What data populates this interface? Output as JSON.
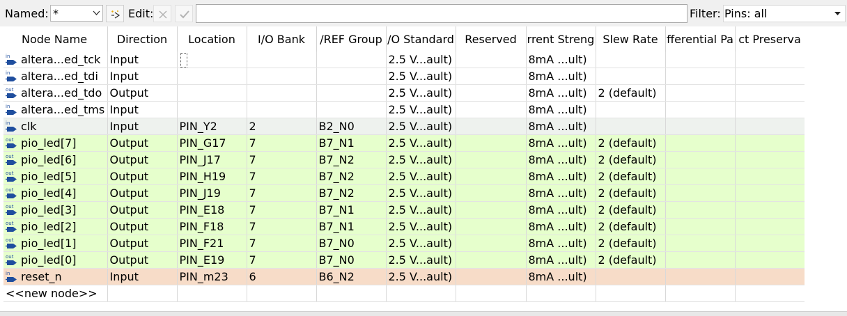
{
  "toolbar": {
    "named_label": "Named:",
    "named_value": "*",
    "edit_label": "Edit:",
    "edit_value": "",
    "filter_label": "Filter:",
    "filter_value": "Pins: all"
  },
  "table": {
    "columns": [
      "Node Name",
      "Direction",
      "Location",
      "I/O Bank",
      "/REF Group",
      "/O Standard",
      "Reserved",
      "rrent Streng",
      "Slew Rate",
      "fferential Pa",
      "ct Preserva"
    ],
    "rows": [
      {
        "dir_icon": "in",
        "name": "altera...ed_tck",
        "direction": "Input",
        "location": "",
        "bank": "",
        "vref": "",
        "std": "2.5 V...ault)",
        "reserved": "",
        "current": "8mA ...ult)",
        "slew": "",
        "diff": "",
        "preserve": "",
        "style": "default",
        "marker": true
      },
      {
        "dir_icon": "in",
        "name": "altera...ed_tdi",
        "direction": "Input",
        "location": "",
        "bank": "",
        "vref": "",
        "std": "2.5 V...ault)",
        "reserved": "",
        "current": "8mA ...ult)",
        "slew": "",
        "diff": "",
        "preserve": "",
        "style": "default"
      },
      {
        "dir_icon": "out",
        "name": "altera...ed_tdo",
        "direction": "Output",
        "location": "",
        "bank": "",
        "vref": "",
        "std": "2.5 V...ault)",
        "reserved": "",
        "current": "8mA ...ult)",
        "slew": "2 (default)",
        "diff": "",
        "preserve": "",
        "style": "default"
      },
      {
        "dir_icon": "in",
        "name": "altera...ed_tms",
        "direction": "Input",
        "location": "",
        "bank": "",
        "vref": "",
        "std": "2.5 V...ault)",
        "reserved": "",
        "current": "8mA ...ult)",
        "slew": "",
        "diff": "",
        "preserve": "",
        "style": "default"
      },
      {
        "dir_icon": "in",
        "name": "clk",
        "direction": "Input",
        "location": "PIN_Y2",
        "bank": "2",
        "vref": "B2_N0",
        "std": "2.5 V...ault)",
        "reserved": "",
        "current": "8mA ...ult)",
        "slew": "",
        "diff": "",
        "preserve": "",
        "style": "input"
      },
      {
        "dir_icon": "out",
        "name": "pio_led[7]",
        "direction": "Output",
        "location": "PIN_G17",
        "bank": "7",
        "vref": "B7_N1",
        "std": "2.5 V...ault)",
        "reserved": "",
        "current": "8mA ...ult)",
        "slew": "2 (default)",
        "diff": "",
        "preserve": "",
        "style": "output"
      },
      {
        "dir_icon": "out",
        "name": "pio_led[6]",
        "direction": "Output",
        "location": "PIN_J17",
        "bank": "7",
        "vref": "B7_N2",
        "std": "2.5 V...ault)",
        "reserved": "",
        "current": "8mA ...ult)",
        "slew": "2 (default)",
        "diff": "",
        "preserve": "",
        "style": "output"
      },
      {
        "dir_icon": "out",
        "name": "pio_led[5]",
        "direction": "Output",
        "location": "PIN_H19",
        "bank": "7",
        "vref": "B7_N2",
        "std": "2.5 V...ault)",
        "reserved": "",
        "current": "8mA ...ult)",
        "slew": "2 (default)",
        "diff": "",
        "preserve": "",
        "style": "output"
      },
      {
        "dir_icon": "out",
        "name": "pio_led[4]",
        "direction": "Output",
        "location": "PIN_J19",
        "bank": "7",
        "vref": "B7_N2",
        "std": "2.5 V...ault)",
        "reserved": "",
        "current": "8mA ...ult)",
        "slew": "2 (default)",
        "diff": "",
        "preserve": "",
        "style": "output"
      },
      {
        "dir_icon": "out",
        "name": "pio_led[3]",
        "direction": "Output",
        "location": "PIN_E18",
        "bank": "7",
        "vref": "B7_N1",
        "std": "2.5 V...ault)",
        "reserved": "",
        "current": "8mA ...ult)",
        "slew": "2 (default)",
        "diff": "",
        "preserve": "",
        "style": "output"
      },
      {
        "dir_icon": "out",
        "name": "pio_led[2]",
        "direction": "Output",
        "location": "PIN_F18",
        "bank": "7",
        "vref": "B7_N1",
        "std": "2.5 V...ault)",
        "reserved": "",
        "current": "8mA ...ult)",
        "slew": "2 (default)",
        "diff": "",
        "preserve": "",
        "style": "output"
      },
      {
        "dir_icon": "out",
        "name": "pio_led[1]",
        "direction": "Output",
        "location": "PIN_F21",
        "bank": "7",
        "vref": "B7_N0",
        "std": "2.5 V...ault)",
        "reserved": "",
        "current": "8mA ...ult)",
        "slew": "2 (default)",
        "diff": "",
        "preserve": "",
        "style": "output"
      },
      {
        "dir_icon": "out",
        "name": "pio_led[0]",
        "direction": "Output",
        "location": "PIN_E19",
        "bank": "7",
        "vref": "B7_N0",
        "std": "2.5 V...ault)",
        "reserved": "",
        "current": "8mA ...ult)",
        "slew": "2 (default)",
        "diff": "",
        "preserve": "",
        "style": "output"
      },
      {
        "dir_icon": "in",
        "name": "reset_n",
        "direction": "Input",
        "location": "PIN_m23",
        "bank": "6",
        "vref": "B6_N2",
        "std": "2.5 V...ault)",
        "reserved": "",
        "current": "8mA ...ult)",
        "slew": "",
        "diff": "",
        "preserve": "",
        "style": "reset"
      }
    ],
    "new_node_label": "<<new node>>"
  },
  "colors": {
    "input_row": "#eef2ee",
    "output_row": "#e6ffcc",
    "reset_row": "#f7dcc8",
    "pin_icon": "#1f4e9e"
  }
}
